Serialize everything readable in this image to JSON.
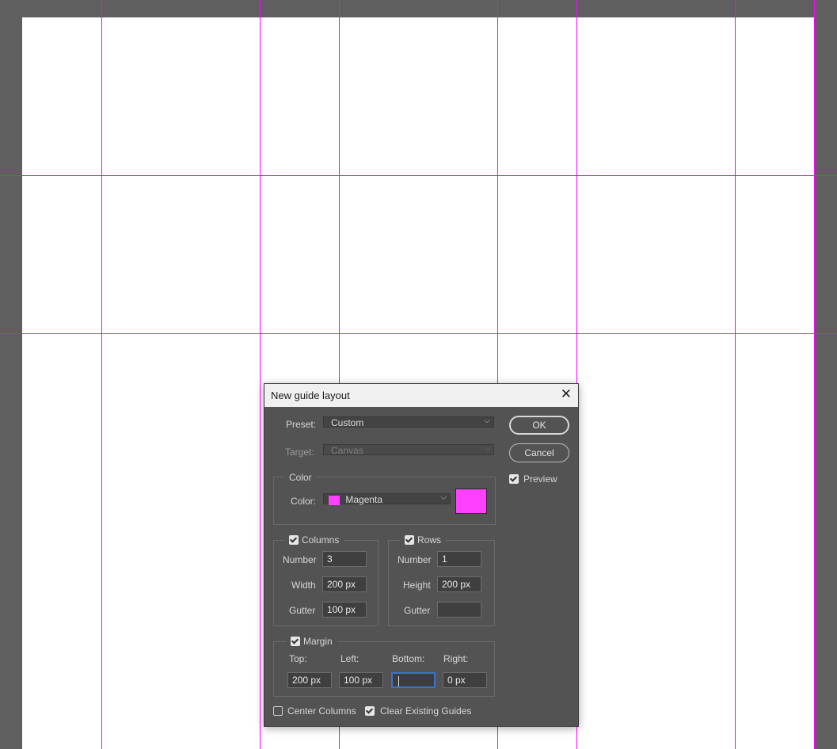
{
  "dialog": {
    "title": "New guide layout",
    "preset": {
      "label": "Preset:",
      "value": "Custom"
    },
    "target": {
      "label": "Target:",
      "value": "Canvas"
    },
    "color_group": {
      "legend": "Color",
      "label": "Color:",
      "value": "Magenta",
      "swatch_color": "#ff40ff"
    },
    "columns": {
      "legend": "Columns",
      "checked": true,
      "number_label": "Number",
      "number": "3",
      "width_label": "Width",
      "width": "200 px",
      "gutter_label": "Gutter",
      "gutter": "100 px"
    },
    "rows": {
      "legend": "Rows",
      "checked": true,
      "number_label": "Number",
      "number": "1",
      "height_label": "Height",
      "height": "200 px",
      "gutter_label": "Gutter",
      "gutter": ""
    },
    "margin": {
      "legend": "Margin",
      "checked": true,
      "top_label": "Top:",
      "top": "200 px",
      "left_label": "Left:",
      "left": "100 px",
      "bottom_label": "Bottom:",
      "bottom": "",
      "right_label": "Right:",
      "right": "0 px"
    },
    "center_columns": {
      "label": "Center Columns",
      "checked": false
    },
    "clear_existing": {
      "label": "Clear Existing Guides",
      "checked": true
    },
    "ok_label": "OK",
    "cancel_label": "Cancel",
    "preview": {
      "label": "Preview",
      "checked": true
    }
  },
  "colors": {
    "guide": "#ff00ff",
    "canvas": "#ffffff",
    "workspace": "#5f5f5f",
    "dialog_bg": "#535353"
  }
}
